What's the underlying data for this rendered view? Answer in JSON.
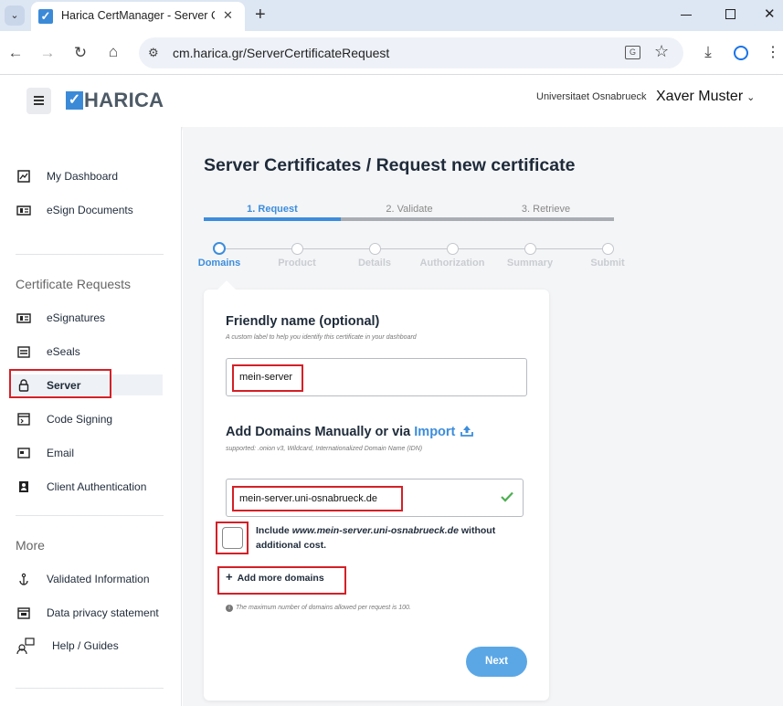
{
  "browser": {
    "tab_title": "Harica CertManager - Server Ce",
    "url": "cm.harica.gr/ServerCertificateRequest",
    "window_controls": [
      "minimize-icon",
      "maximize-icon",
      "close-icon"
    ]
  },
  "header": {
    "logo_text": "HARICA",
    "organization": "Universitaet Osnabrueck",
    "user_name": "Xaver Muster"
  },
  "sidebar": {
    "top_items": [
      {
        "label": "My Dashboard",
        "icon": "dashboard-icon"
      },
      {
        "label": "eSign Documents",
        "icon": "esign-icon"
      }
    ],
    "section_requests": "Certificate Requests",
    "request_items": [
      {
        "label": "eSignatures",
        "icon": "esign-icon"
      },
      {
        "label": "eSeals",
        "icon": "eseal-icon"
      },
      {
        "label": "Server",
        "icon": "lock-icon"
      },
      {
        "label": "Code Signing",
        "icon": "terminal-icon"
      },
      {
        "label": "Email",
        "icon": "email-card-icon"
      },
      {
        "label": "Client Authentication",
        "icon": "badge-icon"
      }
    ],
    "section_more": "More",
    "more_items": [
      {
        "label": "Validated Information",
        "icon": "anchor-icon"
      },
      {
        "label": "Data privacy statement",
        "icon": "privacy-icon"
      },
      {
        "label": "Help / Guides",
        "icon": "help-icon"
      }
    ]
  },
  "page": {
    "title": "Server Certificates / Request new certificate",
    "phases": [
      "1. Request",
      "2. Validate",
      "3. Retrieve"
    ],
    "active_phase": 0,
    "steps": [
      "Domains",
      "Product",
      "Details",
      "Authorization",
      "Summary",
      "Submit"
    ],
    "active_step": 0
  },
  "form": {
    "friendly_name_title": "Friendly name (optional)",
    "friendly_name_hint": "A custom label to help you identify this certificate in your dashboard",
    "friendly_name_value": "mein-server",
    "domains_title": "Add Domains Manually or via",
    "import_label": "Import",
    "domains_hint": "supported: .onion v3, Wildcard, Internationalized Domain Name (IDN)",
    "domain_value": "mein-server.uni-osnabrueck.de",
    "include_prefix": "Include",
    "include_domain": "www.mein-server.uni-osnabrueck.de",
    "include_suffix_1": "without",
    "include_suffix_2": "additional cost.",
    "add_more": "Add more domains",
    "max_note": "The maximum number of domains allowed per request is 100.",
    "next_label": "Next",
    "include_checked": false
  },
  "colors": {
    "accent": "#3c8ddc",
    "title": "#1f2b3a",
    "highlight": "#d42027",
    "next_button": "#5ba7e6",
    "valid": "#4caf50"
  }
}
